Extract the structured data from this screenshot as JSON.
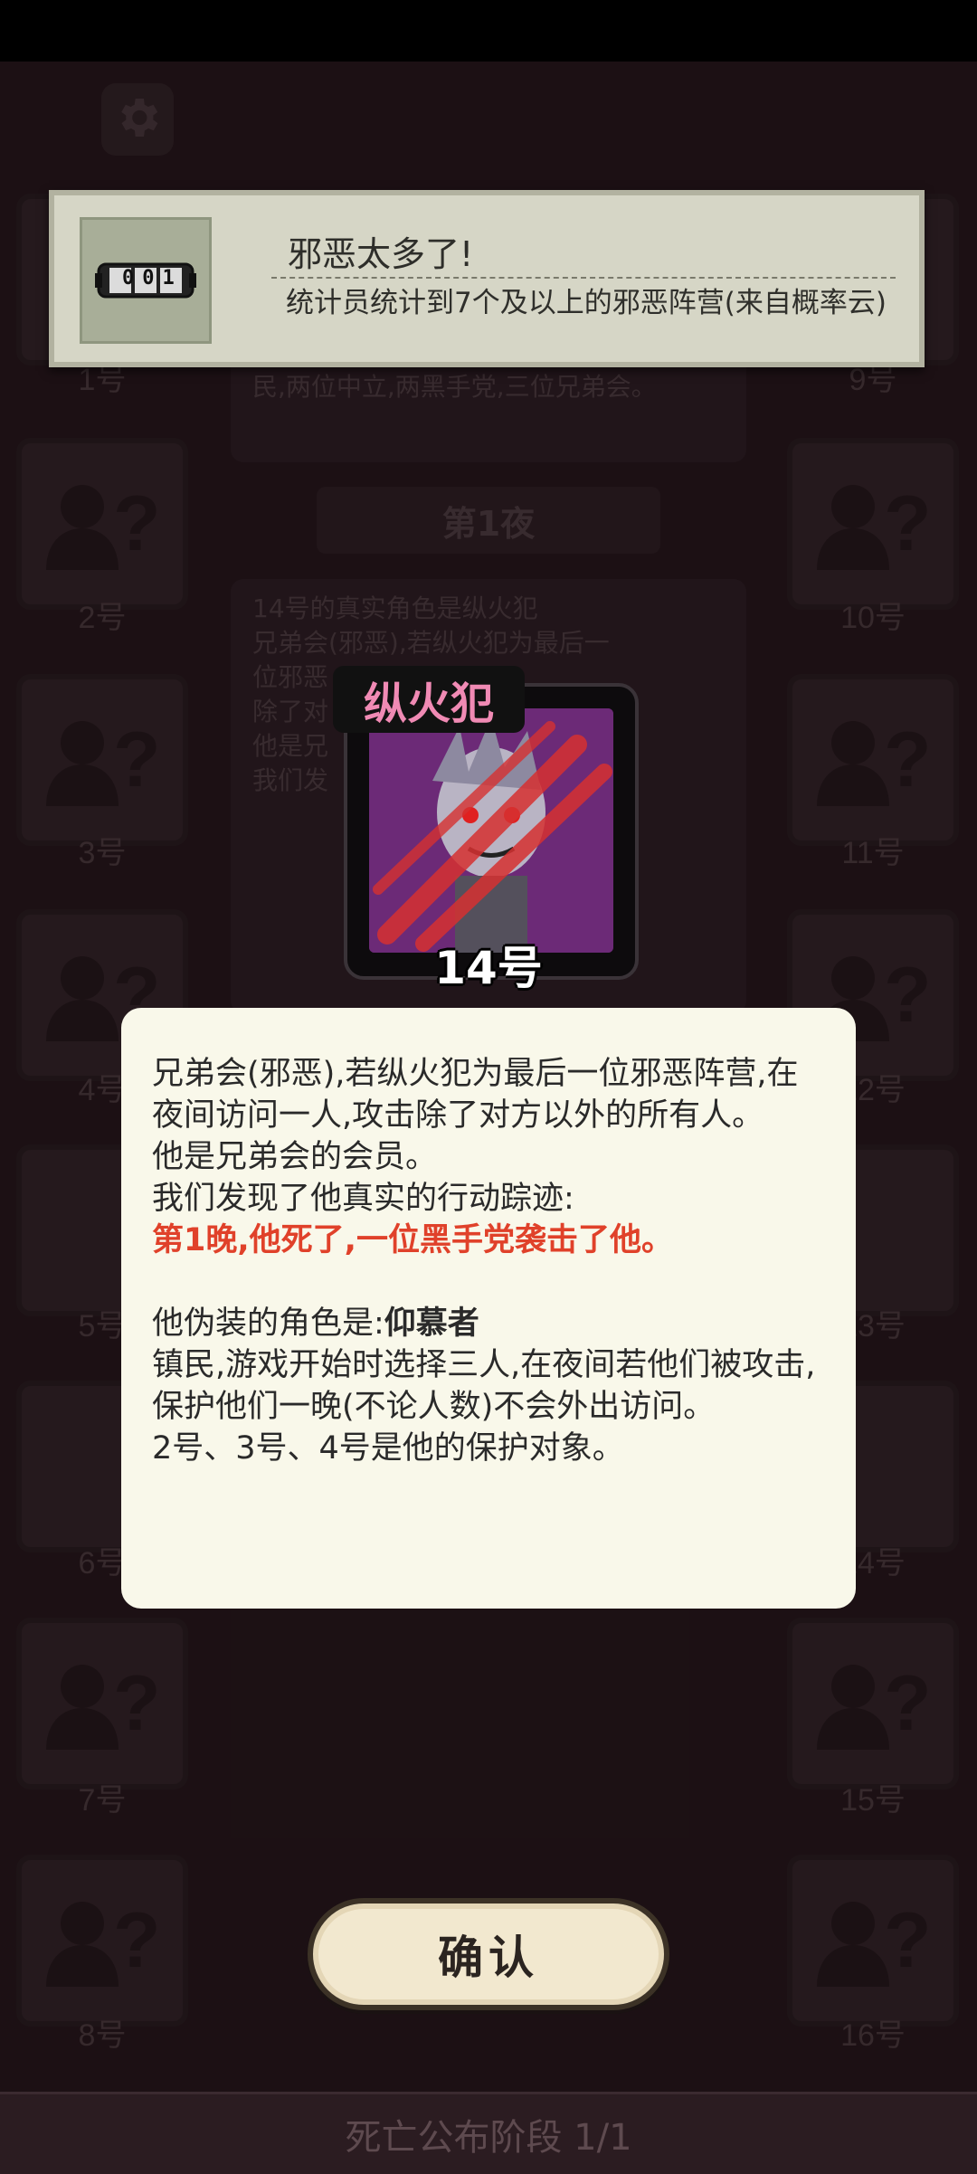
{
  "banner": {
    "counter_text": "001",
    "title": "邪恶太多了!",
    "description": "统计员统计到7个及以上的邪恶阵营(来自概率云)"
  },
  "players": {
    "left": [
      {
        "label": "1号"
      },
      {
        "label": "2号"
      },
      {
        "label": "3号"
      },
      {
        "label": "4号"
      },
      {
        "label": "5号"
      },
      {
        "label": "6号"
      },
      {
        "label": "7号"
      },
      {
        "label": "8号"
      }
    ],
    "right": [
      {
        "label": "9号"
      },
      {
        "label": "10号"
      },
      {
        "label": "11号"
      },
      {
        "label": "12号"
      },
      {
        "label": "13号"
      },
      {
        "label": "14号"
      },
      {
        "label": "15号"
      },
      {
        "label": "16号"
      }
    ]
  },
  "log": {
    "top_snippet": "民,两位中立,两黑手党,三位兄弟会。",
    "night_header": "第1夜",
    "entry_lines": [
      "14号的真实角色是纵火犯",
      "兄弟会(邪恶),若纵火犯为最后一",
      "位邪恶",
      "除了对",
      "他是兄",
      "我们发"
    ]
  },
  "role_card": {
    "role_name": "纵火犯",
    "player_number": "14号"
  },
  "dialog": {
    "line1": "兄弟会(邪恶),若纵火犯为最后一位邪恶阵营,在夜间访问一人,攻击除了对方以外的所有人。",
    "line2": "他是兄弟会的会员。",
    "line3": "我们发现了他真实的行动踪迹:",
    "red_line": "第1晚,他死了,一位黑手党袭击了他。",
    "disguise_prefix": "他伪装的角色是:",
    "disguise_role": "仰慕者",
    "disguise_desc": "镇民,游戏开始时选择三人,在夜间若他们被攻击,保护他们一晚(不论人数)不会外出访问。",
    "protect_line": "2号、3号、4号是他的保护对象。"
  },
  "confirm_button": "确认",
  "phase_text": "死亡公布阶段 1/1",
  "colors": {
    "highlight_red": "#e0412a",
    "role_name_pink": "#f08ab4"
  }
}
